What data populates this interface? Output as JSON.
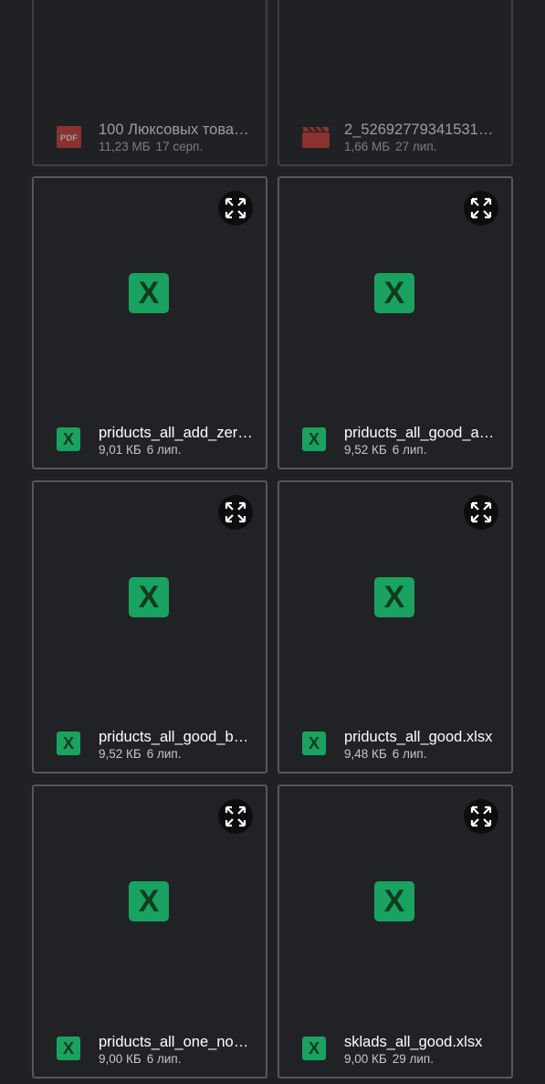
{
  "colors": {
    "background": "#202124",
    "card_border": "#55575c",
    "xlsx_green": "#1aa260",
    "pdf_red": "#e0413a"
  },
  "files": [
    {
      "name": "100 Люксовых товар…",
      "size": "11,23 МБ",
      "date": "17 серп.",
      "icon": "pdf-icon"
    },
    {
      "name": "2_526927793415312…",
      "size": "1,66 МБ",
      "date": "27 лип.",
      "icon": "video-icon"
    },
    {
      "name": "priducts_all_add_zer…",
      "size": "9,01 КБ",
      "date": "6 лип.",
      "icon": "excel-icon"
    },
    {
      "name": "priducts_all_good_a…",
      "size": "9,52 КБ",
      "date": "6 лип.",
      "icon": "excel-icon"
    },
    {
      "name": "priducts_all_good_b…",
      "size": "9,52 КБ",
      "date": "6 лип.",
      "icon": "excel-icon"
    },
    {
      "name": "priducts_all_good.xlsx",
      "size": "9,48 КБ",
      "date": "6 лип.",
      "icon": "excel-icon"
    },
    {
      "name": "priducts_all_one_no…",
      "size": "9,00 КБ",
      "date": "6 лип.",
      "icon": "excel-icon"
    },
    {
      "name": "sklads_all_good.xlsx",
      "size": "9,00 КБ",
      "date": "29 лип.",
      "icon": "excel-icon"
    }
  ],
  "xlsx_glyph": "X",
  "pdf_glyph": "PDF"
}
